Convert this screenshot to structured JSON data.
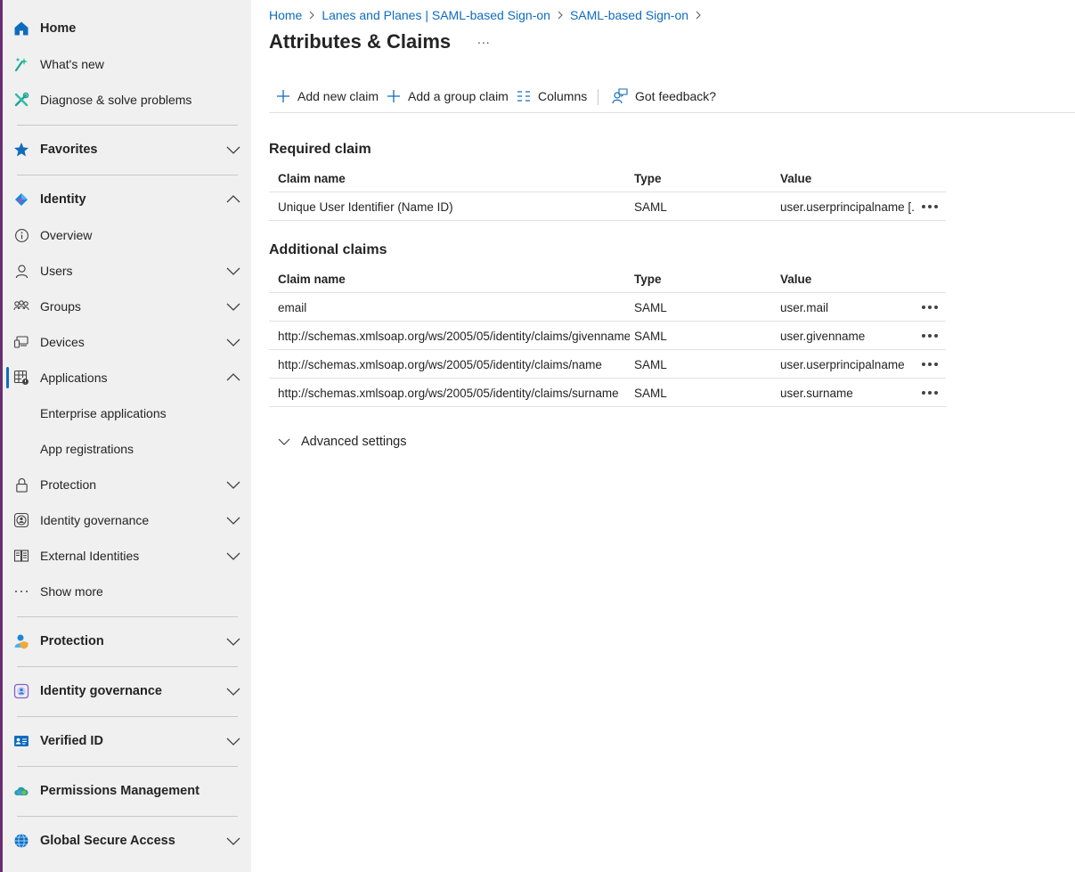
{
  "sidebar": {
    "items": [
      {
        "id": "home",
        "label": "Home",
        "bold": true,
        "icon": "home-icon",
        "chevron": ""
      },
      {
        "id": "whats-new",
        "label": "What's new",
        "bold": false,
        "icon": "sparkle-icon",
        "chevron": ""
      },
      {
        "id": "diagnose",
        "label": "Diagnose & solve problems",
        "bold": false,
        "icon": "wrench-icon",
        "chevron": ""
      },
      {
        "id": "favorites",
        "label": "Favorites",
        "bold": true,
        "icon": "star-icon",
        "chevron": "down"
      },
      {
        "id": "identity",
        "label": "Identity",
        "bold": true,
        "icon": "identity-diamond-icon",
        "chevron": "up"
      },
      {
        "id": "overview",
        "label": "Overview",
        "bold": false,
        "icon": "info-icon",
        "chevron": ""
      },
      {
        "id": "users",
        "label": "Users",
        "bold": false,
        "icon": "user-icon",
        "chevron": "down"
      },
      {
        "id": "groups",
        "label": "Groups",
        "bold": false,
        "icon": "people-icon",
        "chevron": "down"
      },
      {
        "id": "devices",
        "label": "Devices",
        "bold": false,
        "icon": "devices-icon",
        "chevron": "down"
      },
      {
        "id": "applications",
        "label": "Applications",
        "bold": false,
        "icon": "apps-grid-icon",
        "chevron": "up"
      },
      {
        "id": "enterprise-apps",
        "label": "Enterprise applications",
        "bold": false,
        "icon": "",
        "chevron": ""
      },
      {
        "id": "app-registrations",
        "label": "App registrations",
        "bold": false,
        "icon": "",
        "chevron": ""
      },
      {
        "id": "protection-sub",
        "label": "Protection",
        "bold": false,
        "icon": "lock-icon",
        "chevron": "down"
      },
      {
        "id": "id-governance-sub",
        "label": "Identity governance",
        "bold": false,
        "icon": "governance-icon",
        "chevron": "down"
      },
      {
        "id": "external-identities",
        "label": "External Identities",
        "bold": false,
        "icon": "external-identities-icon",
        "chevron": "down"
      },
      {
        "id": "show-more",
        "label": "Show more",
        "bold": false,
        "icon": "ellipsis-icon",
        "chevron": ""
      },
      {
        "id": "protection",
        "label": "Protection",
        "bold": true,
        "icon": "protection-person-icon",
        "chevron": "down"
      },
      {
        "id": "identity-governance",
        "label": "Identity governance",
        "bold": true,
        "icon": "governance-colored-icon",
        "chevron": "down"
      },
      {
        "id": "verified-id",
        "label": "Verified ID",
        "bold": true,
        "icon": "verified-id-card-icon",
        "chevron": "down"
      },
      {
        "id": "permissions-mgmt",
        "label": "Permissions Management",
        "bold": true,
        "icon": "cloud-permissions-icon",
        "chevron": ""
      },
      {
        "id": "global-secure-access",
        "label": "Global Secure Access",
        "bold": true,
        "icon": "globe-icon",
        "chevron": "down"
      }
    ]
  },
  "breadcrumb": {
    "items": [
      "Home",
      "Lanes and Planes | SAML-based Sign-on",
      "SAML-based Sign-on"
    ]
  },
  "page": {
    "title": "Attributes & Claims",
    "more": "..."
  },
  "toolbar": {
    "add_claim": "Add new claim",
    "add_group_claim": "Add a group claim",
    "columns": "Columns",
    "feedback": "Got feedback?"
  },
  "required": {
    "title": "Required claim",
    "headers": {
      "name": "Claim name",
      "type": "Type",
      "value": "Value"
    },
    "rows": [
      {
        "name": "Unique User Identifier (Name ID)",
        "type": "SAML",
        "value": "user.userprincipalname [..."
      }
    ]
  },
  "additional": {
    "title": "Additional claims",
    "headers": {
      "name": "Claim name",
      "type": "Type",
      "value": "Value"
    },
    "rows": [
      {
        "name": "email",
        "type": "SAML",
        "value": "user.mail"
      },
      {
        "name": "http://schemas.xmlsoap.org/ws/2005/05/identity/claims/givenname",
        "type": "SAML",
        "value": "user.givenname"
      },
      {
        "name": "http://schemas.xmlsoap.org/ws/2005/05/identity/claims/name",
        "type": "SAML",
        "value": "user.userprincipalname"
      },
      {
        "name": "http://schemas.xmlsoap.org/ws/2005/05/identity/claims/surname",
        "type": "SAML",
        "value": "user.surname"
      }
    ]
  },
  "advanced": {
    "label": "Advanced settings"
  },
  "colors": {
    "accent": "#0f6cbd",
    "sidebar_bg": "#f0f0f0",
    "left_border": "#6b2c73"
  }
}
